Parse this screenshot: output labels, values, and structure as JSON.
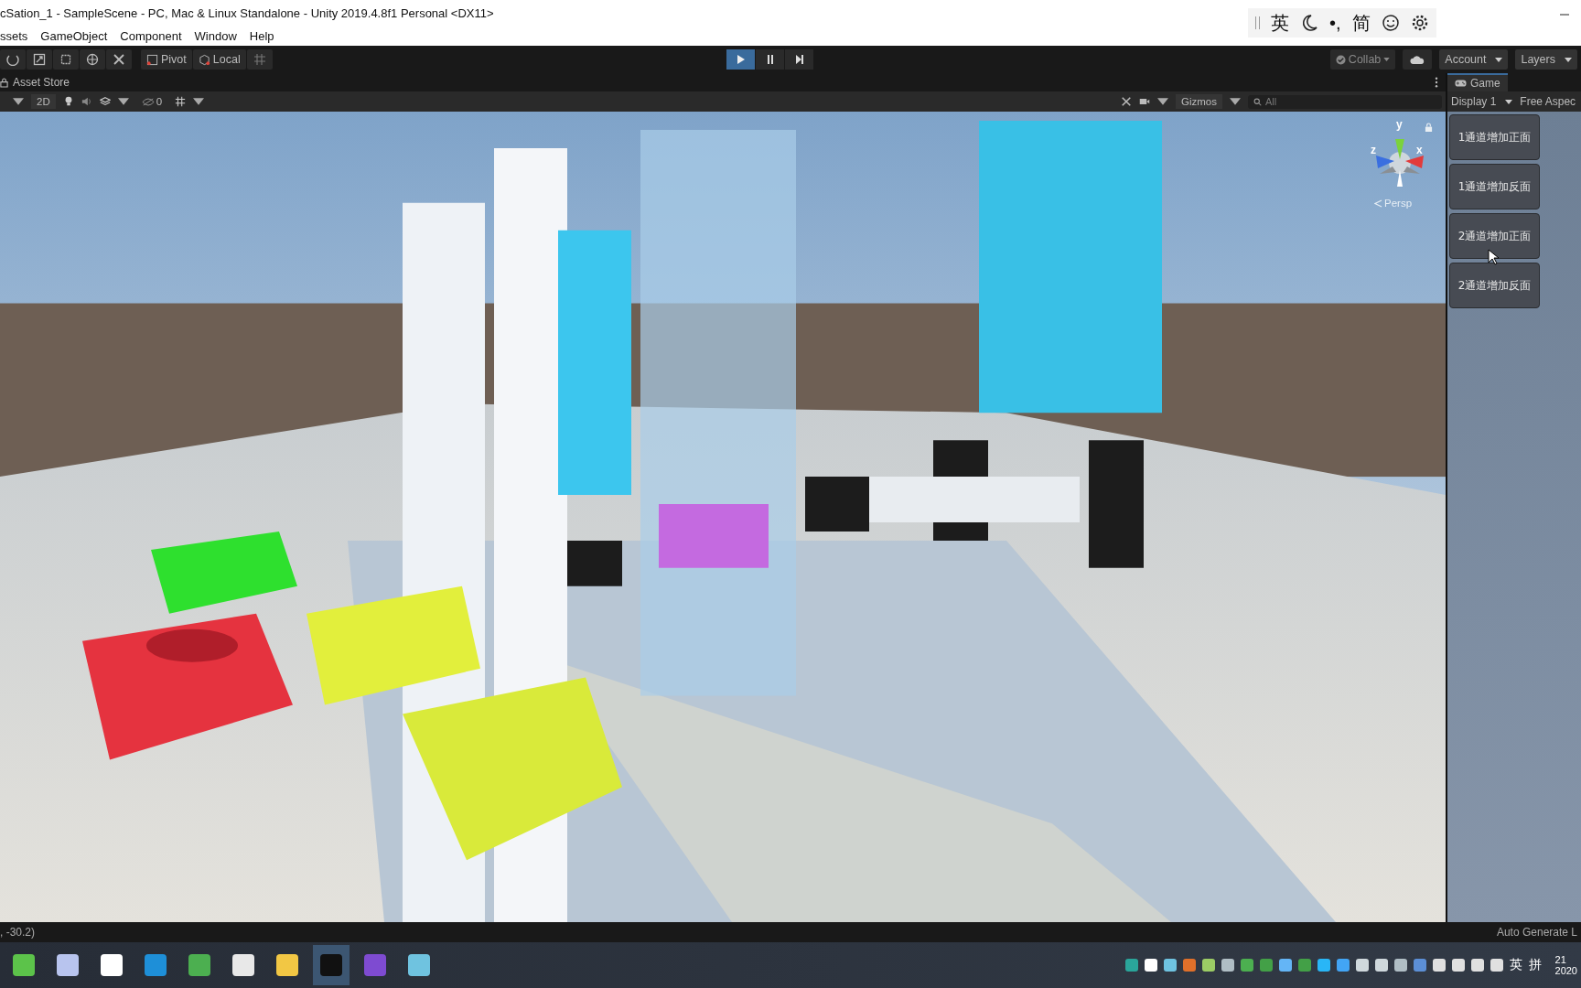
{
  "window": {
    "title": "cSation_1 - SampleScene - PC, Mac & Linux Standalone - Unity 2019.4.8f1 Personal <DX11>"
  },
  "ime_bar": [
    {
      "kind": "text",
      "label": "英"
    },
    {
      "kind": "moon"
    },
    {
      "kind": "text",
      "label": "•,"
    },
    {
      "kind": "text",
      "label": "简"
    },
    {
      "kind": "smiley"
    },
    {
      "kind": "gear"
    }
  ],
  "menu": [
    "ssets",
    "GameObject",
    "Component",
    "Window",
    "Help"
  ],
  "toolbar": {
    "pivot": "Pivot",
    "local": "Local",
    "play_controls": [
      {
        "kind": "play",
        "selected": true
      },
      {
        "kind": "pause",
        "selected": false
      },
      {
        "kind": "step",
        "selected": false
      }
    ],
    "collab": "Collab",
    "account": "Account",
    "layers": "Layers"
  },
  "scene": {
    "tab": "Asset Store",
    "mode_2d": "2D",
    "hidden_count": "0",
    "gizmos": "Gizmos",
    "search_placeholder": "All",
    "axes": [
      "y",
      "z",
      "x"
    ],
    "projection": "Persp"
  },
  "game": {
    "tab": "Game",
    "display": "Display 1",
    "aspect": "Free Aspec",
    "buttons": [
      "1通道增加正面",
      "1通道增加反面",
      "2通道增加正面",
      "2通道增加反面"
    ]
  },
  "status_bar": {
    "left": ", -30.2)",
    "right": "Auto Generate L"
  },
  "taskbar": {
    "apps": [
      {
        "color": "#5cc34a",
        "selected": false
      },
      {
        "color": "#b8c4ee",
        "selected": false
      },
      {
        "color": "#ffffff",
        "selected": false
      },
      {
        "color": "#1e8fd8",
        "selected": false
      },
      {
        "color": "#4caf50",
        "selected": false
      },
      {
        "color": "#e8e8e8",
        "selected": false
      },
      {
        "color": "#f2c744",
        "selected": false
      },
      {
        "color": "#111111",
        "selected": true
      },
      {
        "color": "#7e4bd1",
        "selected": false
      },
      {
        "color": "#6fc3e0",
        "selected": false
      }
    ],
    "tray_text": [
      "英",
      "拼"
    ],
    "clock": [
      "21",
      "2020"
    ]
  }
}
